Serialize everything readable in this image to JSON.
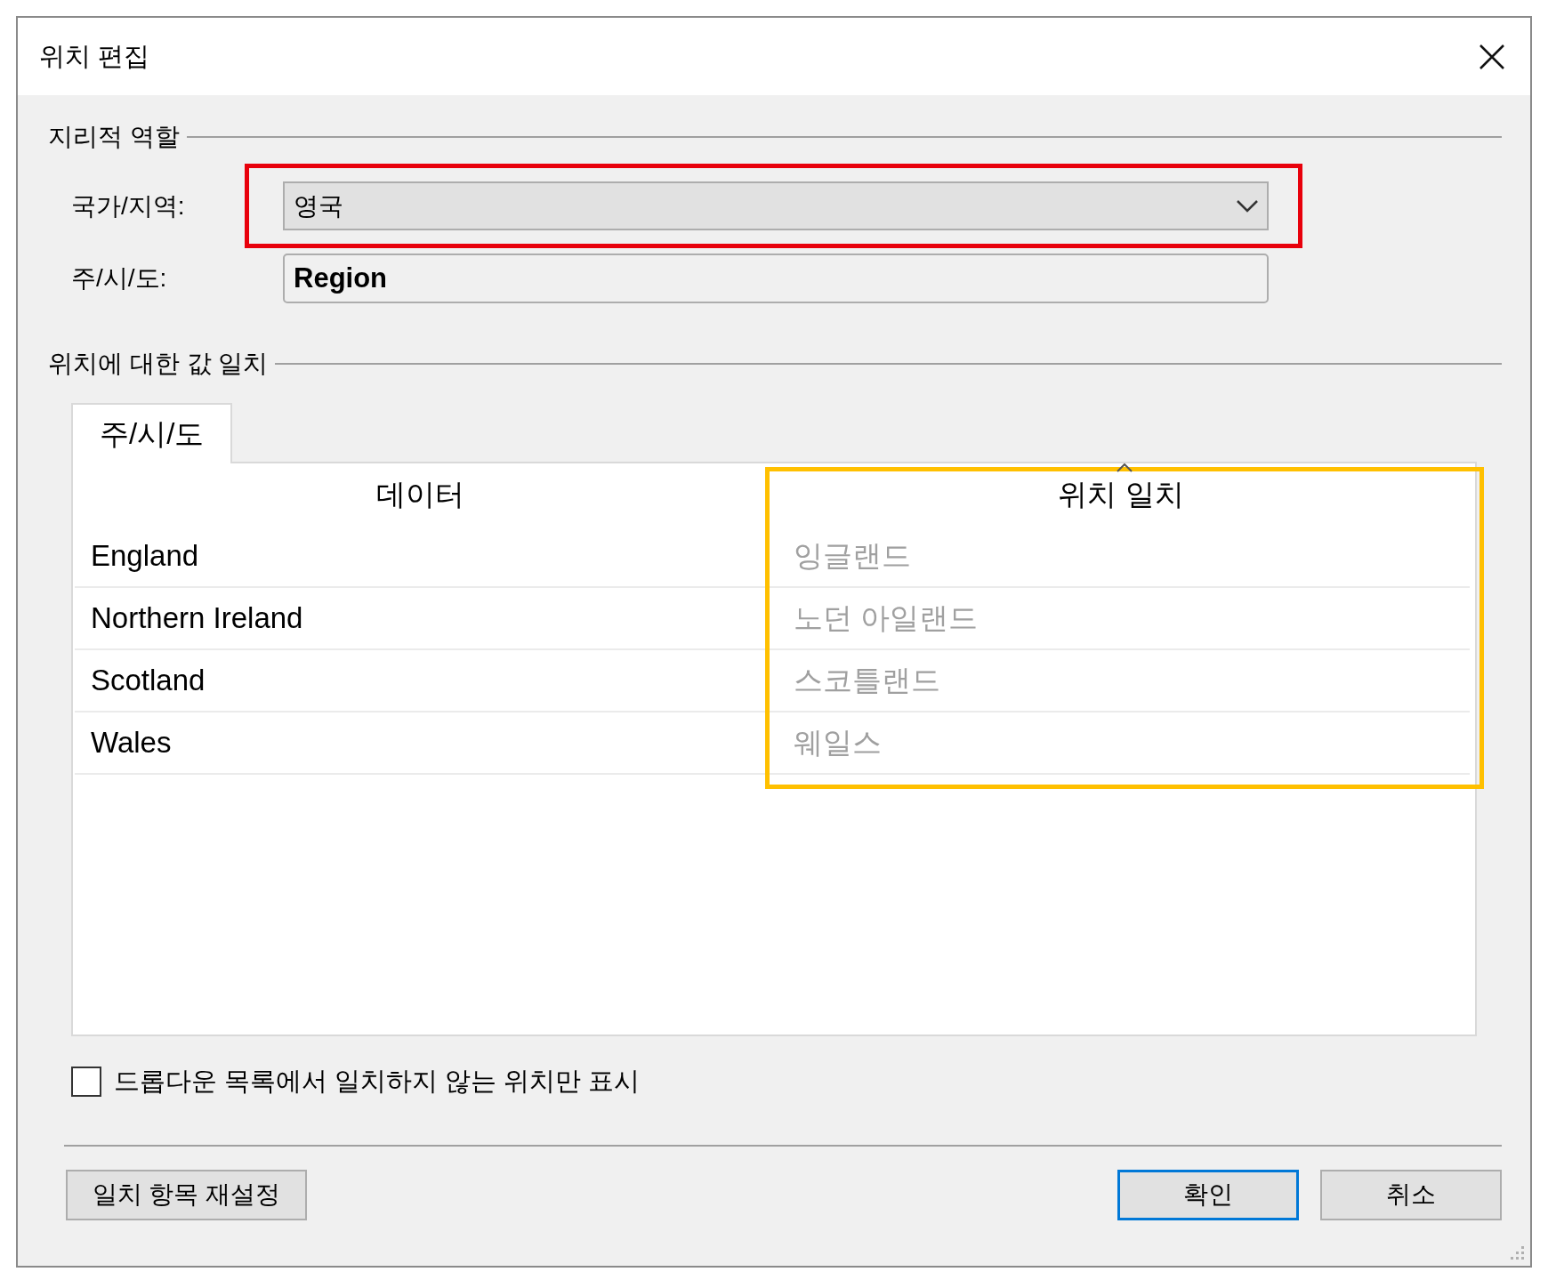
{
  "window": {
    "title": "위치 편집"
  },
  "geographic_role": {
    "label": "지리적 역할",
    "country_label": "국가/지역:",
    "country_value": "영국",
    "state_label": "주/시/도:",
    "state_value": "Region"
  },
  "match_group": {
    "label": "위치에 대한 값 일치",
    "tabs": [
      {
        "label": "주/시/도",
        "selected": true
      }
    ],
    "columns": [
      "데이터",
      "위치 일치"
    ],
    "rows": [
      {
        "data": "England",
        "match": "잉글랜드"
      },
      {
        "data": "Northern Ireland",
        "match": "노던 아일랜드"
      },
      {
        "data": "Scotland",
        "match": "스코틀랜드"
      },
      {
        "data": "Wales",
        "match": "웨일스"
      }
    ]
  },
  "checkbox": {
    "label": "드롭다운 목록에서 일치하지 않는 위치만 표시",
    "checked": false
  },
  "buttons": [
    {
      "label": "일치 항목 재설정",
      "kind": "plain"
    },
    {
      "label": "확인",
      "kind": "default"
    },
    {
      "label": "취소",
      "kind": "plain"
    }
  ],
  "highlights": [
    {
      "color": "#e8000b"
    },
    {
      "color": "#ffc000"
    }
  ]
}
